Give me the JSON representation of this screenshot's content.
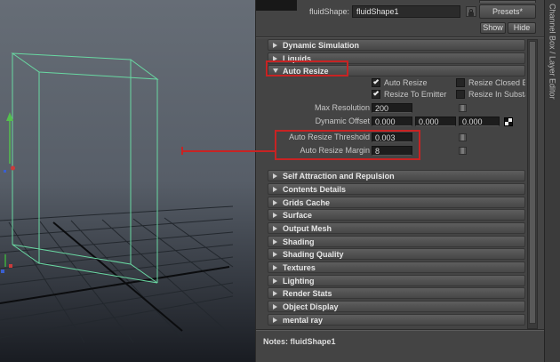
{
  "colors": {
    "annotation_red": "#c82323",
    "panel_bg": "#444444",
    "wireframe_green": "#69d8a2",
    "field_bg": "#1d1d1d"
  },
  "header": {
    "name_label": "fluidShape:",
    "name_value": "fluidShape1",
    "presets_button": "Presets*",
    "show_button": "Show",
    "hide_button": "Hide"
  },
  "side_tab": {
    "label": "Channel Box / Layer Editor"
  },
  "sections_top": [
    {
      "label": "Dynamic Simulation"
    },
    {
      "label": "Liquids"
    },
    {
      "label": "Auto Resize"
    }
  ],
  "auto_resize": {
    "auto_resize_checkbox_label": "Auto Resize",
    "resize_closed_checkbox_label": "Resize Closed B",
    "resize_to_emitter_checkbox_label": "Resize To Emitter",
    "resize_in_substeps_checkbox_label": "Resize In Substa",
    "max_resolution_label": "Max Resolution",
    "max_resolution_value": "200",
    "dynamic_offset_label": "Dynamic Offset",
    "dynamic_offset_x": "0.000",
    "dynamic_offset_y": "0.000",
    "dynamic_offset_z": "0.000",
    "threshold_label": "Auto Resize Threshold",
    "threshold_value": "0.003",
    "margin_label": "Auto Resize Margin",
    "margin_value": "8"
  },
  "sections_bottom": [
    "Self Attraction and Repulsion",
    "Contents Details",
    "Grids Cache",
    "Surface",
    "Output Mesh",
    "Shading",
    "Shading Quality",
    "Textures",
    "Lighting",
    "Render Stats",
    "Object Display",
    "mental ray"
  ],
  "notes": {
    "text": "Notes: fluidShape1"
  }
}
